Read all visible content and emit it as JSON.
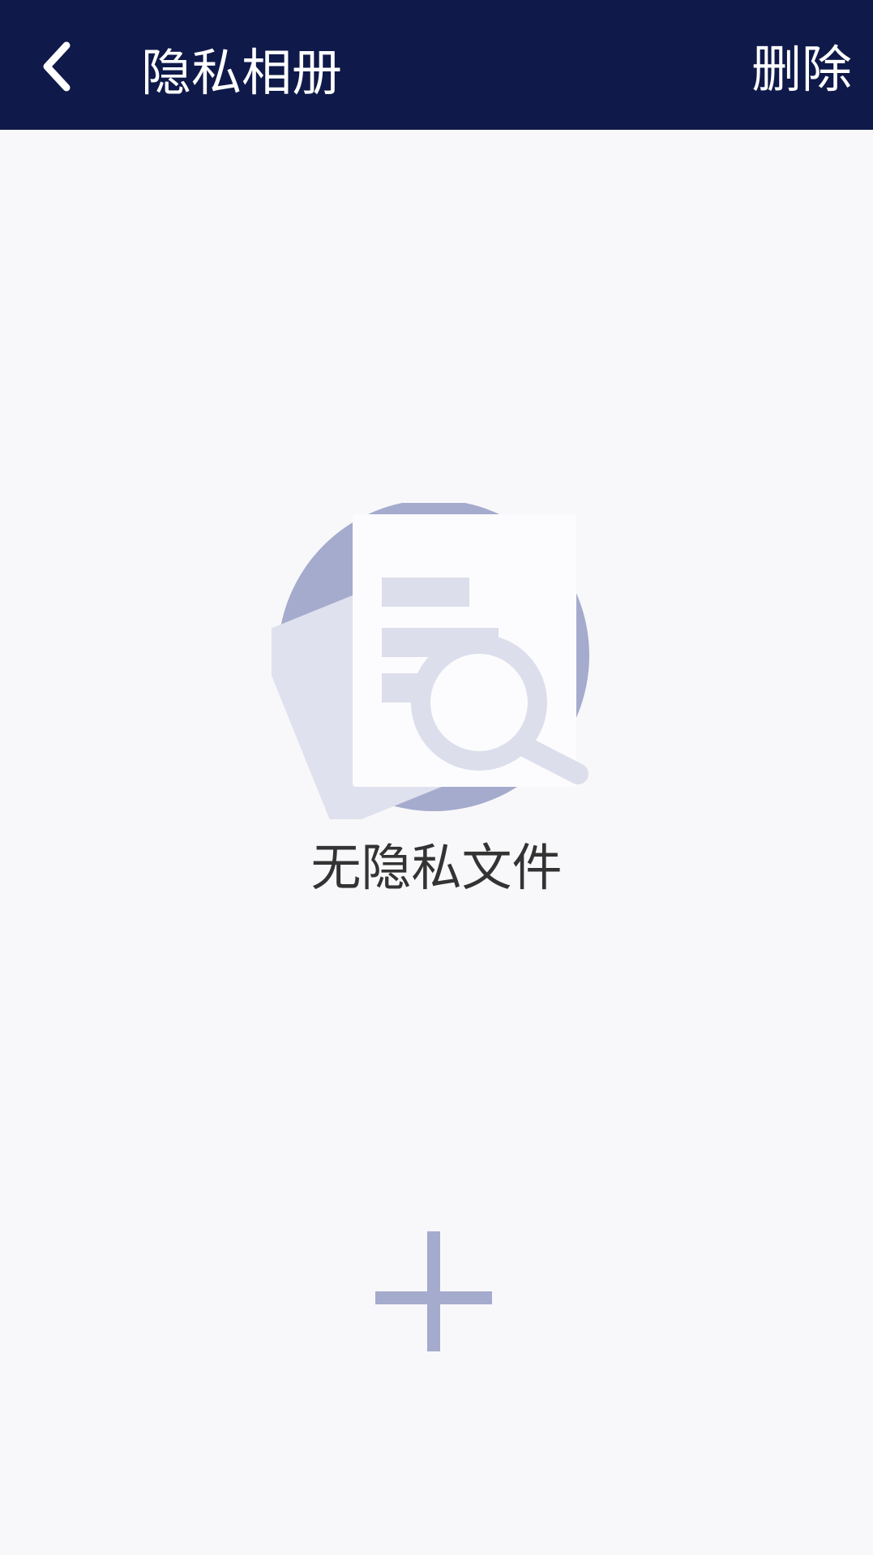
{
  "header": {
    "title": "隐私相册",
    "back_icon": "chevron-left-icon",
    "delete_label": "删除"
  },
  "empty_state": {
    "icon": "document-search-icon",
    "message": "无隐私文件"
  },
  "actions": {
    "add_icon": "plus-icon"
  },
  "colors": {
    "header_bg": "#0f1a4a",
    "page_bg": "#f8f8fa",
    "accent": "#a5abcd",
    "text_dark": "#333333"
  }
}
